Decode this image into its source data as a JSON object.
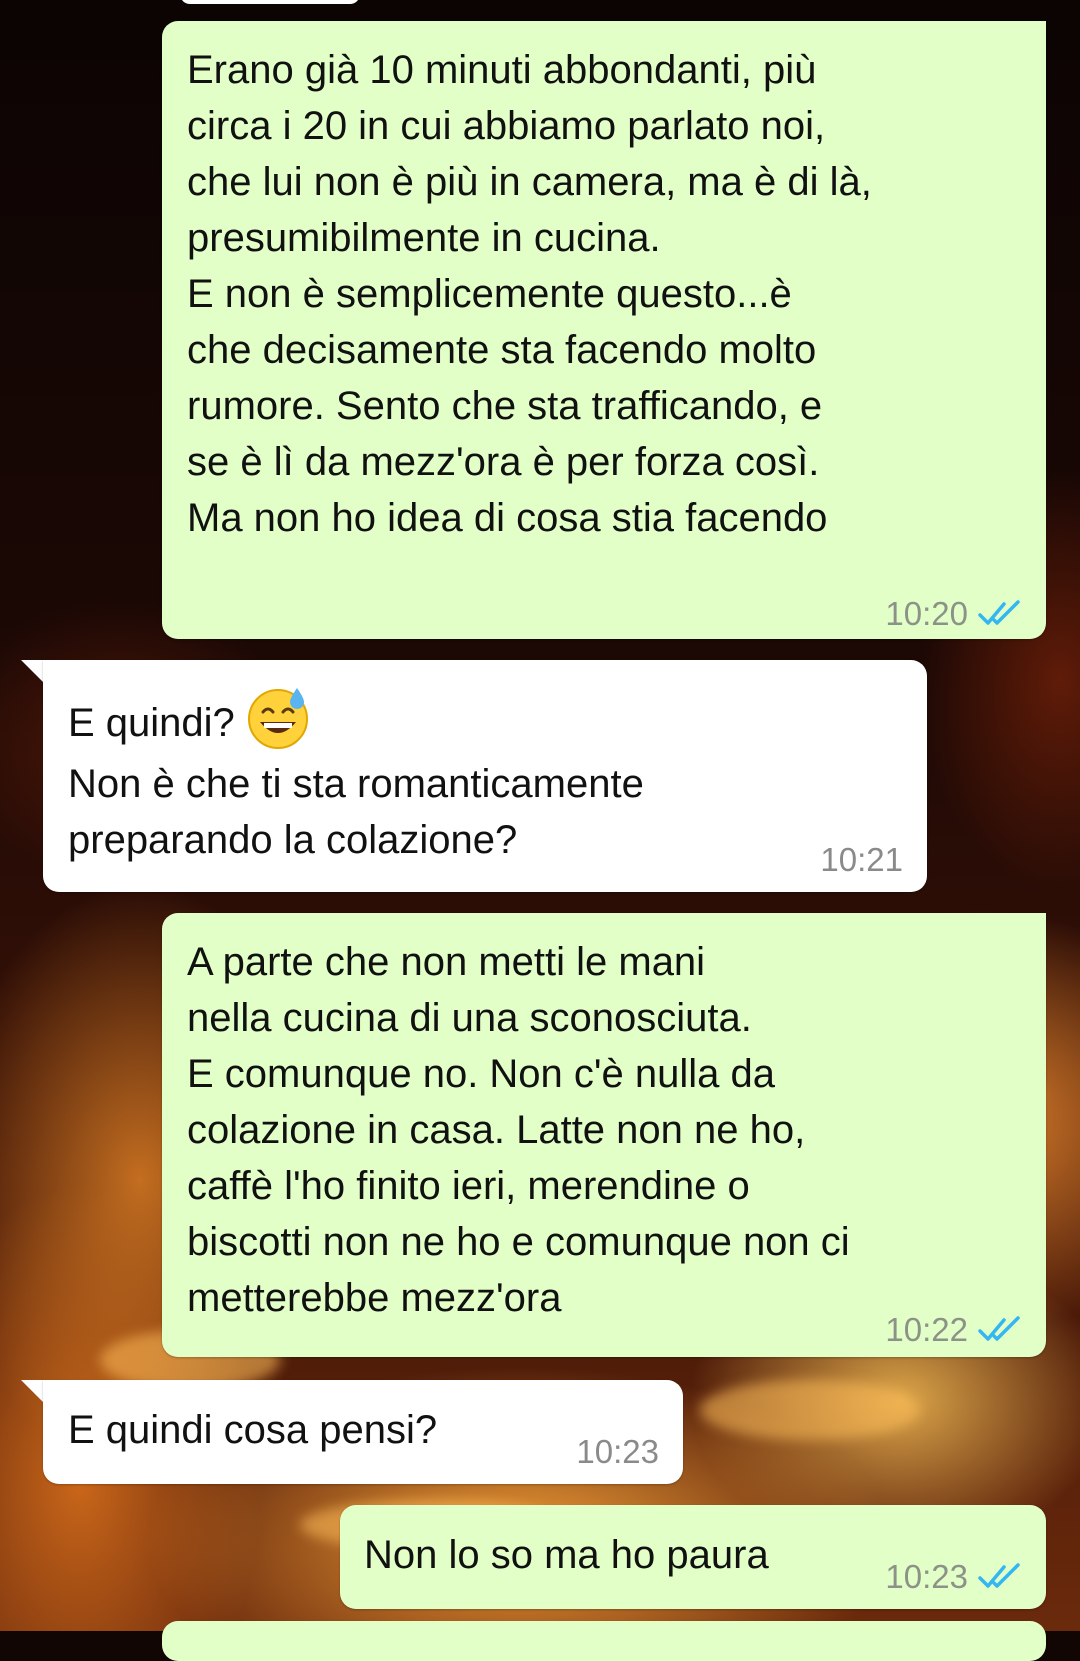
{
  "messages": [
    {
      "direction": "outgoing",
      "text": "Erano già 10 minuti abbondanti, più\ncirca i 20 in cui abbiamo parlato noi,\nche lui non è più in camera, ma è di là,\npresumibilmente in cucina.\nE non è semplicemente questo...è\nche decisamente sta facendo molto\nrumore. Sento che sta trafficando, e\nse è lì da mezz'ora è per forza così.\nMa non ho idea di cosa stia facendo",
      "time": "10:20",
      "status_icon": "double-check-read-icon"
    },
    {
      "direction": "incoming",
      "text_before_emoji": "E quindi?",
      "emoji": "grinning-face-with-sweat-icon",
      "text_after_emoji": "Non è che ti sta romanticamente\npreparando la colazione?",
      "time": "10:21"
    },
    {
      "direction": "outgoing",
      "text": "A parte che non metti le mani\nnella cucina di una sconosciuta.\nE comunque no. Non c'è nulla da\ncolazione in casa. Latte non ne ho,\ncaffè l'ho finito ieri, merendine o\nbiscotti non ne ho e comunque non ci\nmetterebbe mezz'ora",
      "time": "10:22",
      "status_icon": "double-check-read-icon"
    },
    {
      "direction": "incoming",
      "text": "E quindi cosa pensi?",
      "time": "10:23"
    },
    {
      "direction": "outgoing",
      "text": "Non lo so ma ho paura",
      "time": "10:23",
      "status_icon": "double-check-read-icon"
    }
  ],
  "colors": {
    "outgoing_bubble": "#e2ffc8",
    "incoming_bubble": "#ffffff",
    "read_ticks": "#34b7f1",
    "timestamp": "#8c9287"
  }
}
